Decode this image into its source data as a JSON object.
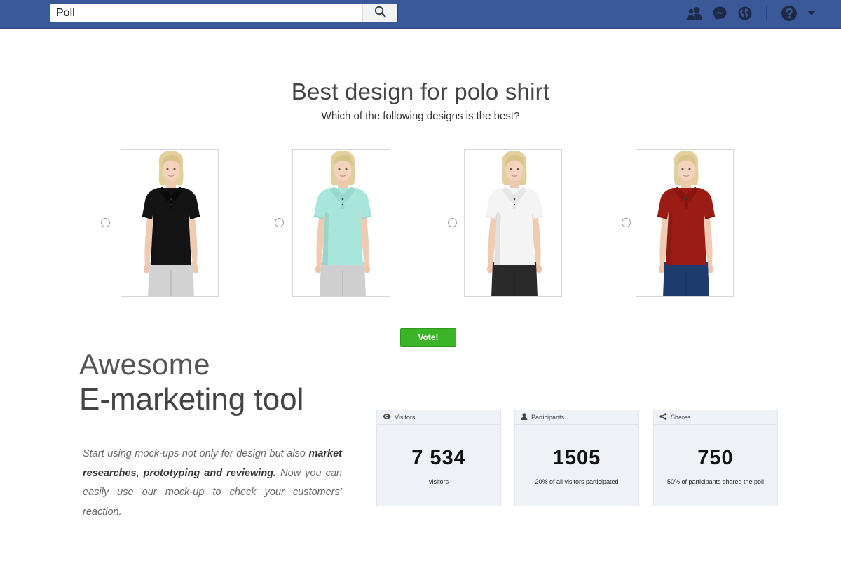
{
  "topbar": {
    "search_value": "Poll",
    "search_placeholder": "Search",
    "icons": [
      "friends-icon",
      "messenger-icon",
      "globe-icon",
      "help-icon",
      "caret-down-icon"
    ],
    "brand_color": "#3b5998"
  },
  "poll": {
    "title": "Best design for polo shirt",
    "question": "Which of the following designs is the best?",
    "options": [
      {
        "shirt_color": "#141414",
        "collar_color": "#0b0b0b",
        "pants_color": "#d2d2d2"
      },
      {
        "shirt_color": "#a8e6dc",
        "collar_color": "#98d8ce",
        "pants_color": "#cfcfcf"
      },
      {
        "shirt_color": "#f4f4f4",
        "collar_color": "#e6e6e6",
        "pants_color": "#2a2a2a"
      },
      {
        "shirt_color": "#9b1c14",
        "collar_color": "#86160f",
        "pants_color": "#1f3c6e"
      }
    ],
    "vote_label": "Vote!",
    "vote_color": "#3cb427"
  },
  "marketing": {
    "headline_line1": "Awesome",
    "headline_line2": "E-marketing tool",
    "text_part1": "Start using mock-ups not only for design but also ",
    "text_bold": "market researches, prototyping and reviewing.",
    "text_part2": " Now you can easily use our mock-up to check your customers’ reaction."
  },
  "stats": [
    {
      "label": "Visitors",
      "icon": "eye-icon",
      "value": "7 534",
      "caption": "visitors"
    },
    {
      "label": "Participants",
      "icon": "user-icon",
      "value": "1505",
      "caption": "20% of all visitors participated"
    },
    {
      "label": "Shares",
      "icon": "share-icon",
      "value": "750",
      "caption": "50% of participants shared the poll"
    }
  ]
}
